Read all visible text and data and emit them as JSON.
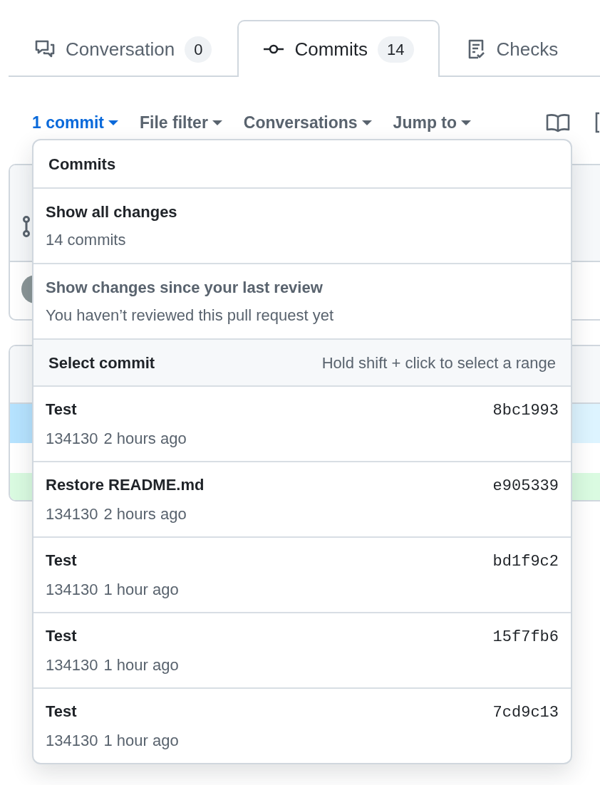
{
  "tabs": [
    {
      "label": "Conversation",
      "count": "0",
      "kind": "conversation",
      "selected": false
    },
    {
      "label": "Commits",
      "count": "14",
      "kind": "commits",
      "selected": true
    },
    {
      "label": "Checks",
      "kind": "checks",
      "selected": false
    }
  ],
  "toolbar": [
    {
      "label": "1 commit",
      "selected": true
    },
    {
      "label": "File filter",
      "selected": false
    },
    {
      "label": "Conversations",
      "selected": false
    },
    {
      "label": "Jump to",
      "selected": false
    }
  ],
  "dropdown": {
    "title": "Commits",
    "options": [
      {
        "title": "Show all changes",
        "subtitle": "14 commits",
        "disabled": false
      },
      {
        "title": "Show changes since your last review",
        "subtitle": "You haven’t reviewed this pull request yet",
        "disabled": true
      }
    ],
    "section": {
      "title": "Select commit",
      "hint": "Hold shift + click to select a range"
    },
    "commits": [
      {
        "message": "Test",
        "author": "134130",
        "time": "2 hours ago",
        "sha": "8bc1993"
      },
      {
        "message": "Restore README.md",
        "author": "134130",
        "time": "2 hours ago",
        "sha": "e905339"
      },
      {
        "message": "Test",
        "author": "134130",
        "time": "1 hour ago",
        "sha": "bd1f9c2"
      },
      {
        "message": "Test",
        "author": "134130",
        "time": "1 hour ago",
        "sha": "15f7fb6"
      },
      {
        "message": "Test",
        "author": "134130",
        "time": "1 hour ago",
        "sha": "7cd9c13"
      }
    ]
  }
}
